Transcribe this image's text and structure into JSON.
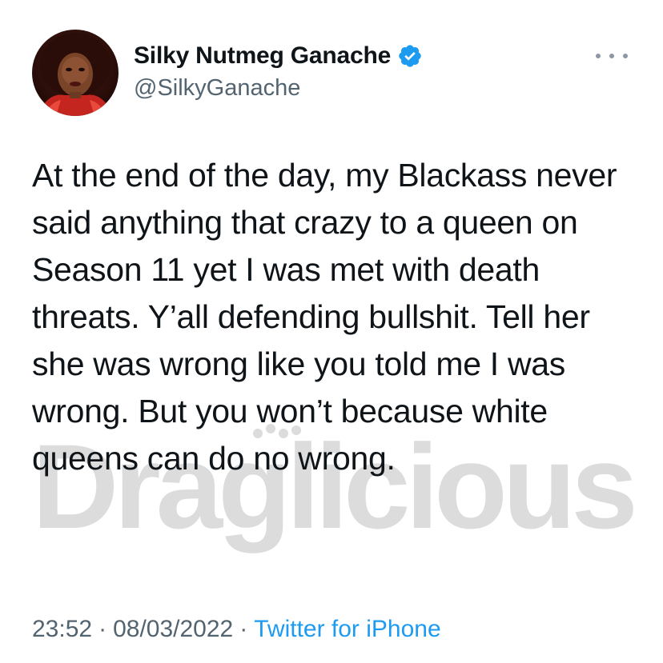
{
  "user": {
    "display_name": "Silky Nutmeg Ganache",
    "handle": "@SilkyGanache",
    "verified_icon": "verified-badge-icon"
  },
  "tweet": {
    "text": "At the end of the day, my Blackass never said anything that crazy to a queen on Season 11 yet I was met with death threats. Y’all defending bullshit. Tell her she was wrong like you told me I was wrong. But you won’t because white queens can do no wrong."
  },
  "meta": {
    "time": "23:52",
    "separator": "·",
    "date": "08/03/2022",
    "source": "Twitter for iPhone"
  },
  "watermark": {
    "text": "Draglicious"
  },
  "colors": {
    "text": "#0f1419",
    "secondary": "#536471",
    "link": "#1d9bf0",
    "watermark": "#d9d9d9"
  }
}
